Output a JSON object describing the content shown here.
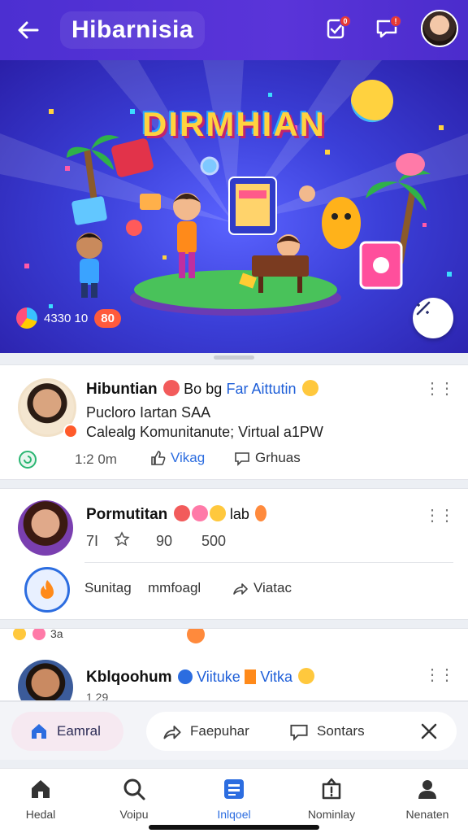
{
  "header": {
    "title": "Hibarnisia",
    "notif_badge": "0",
    "chat_badge": "!"
  },
  "hero": {
    "title": "DIRMHIAN",
    "stat_number": "4330 10",
    "stat_pill": "80"
  },
  "posts": [
    {
      "name": "Hibuntian",
      "tag_text": "Bo bg",
      "tag_link": "Far Aittutin",
      "line1": "Pucloro Iartan SAA",
      "line2": "Calealg Komunitanute; Virtual a1PW",
      "time": "1:2 0m",
      "like_label": "Vikag",
      "comment_label": "Grhuas"
    },
    {
      "name": "Pormutitan",
      "extra": "lab",
      "stat1": "7I",
      "stat2": "90",
      "stat3": "500",
      "action1": "Sunitag",
      "action2": "mmfoagl",
      "action3": "Viatac"
    },
    {
      "name": "Kblqoohum",
      "tag_link": "Viituke",
      "tag2": "Vitka",
      "peek_num": "3a",
      "sub": "1 29"
    }
  ],
  "action_bar": {
    "primary": "Eamral",
    "item2": "Faepuhar",
    "item3": "Sontars"
  },
  "nav": [
    {
      "label": "Hedal"
    },
    {
      "label": "Voipu"
    },
    {
      "label": "Inlqoel"
    },
    {
      "label": "Nominlay"
    },
    {
      "label": "Nenaten"
    }
  ],
  "colors": {
    "header": "#4c2fd1",
    "accent_blue": "#2c6de0",
    "badge_red": "#e53935"
  }
}
